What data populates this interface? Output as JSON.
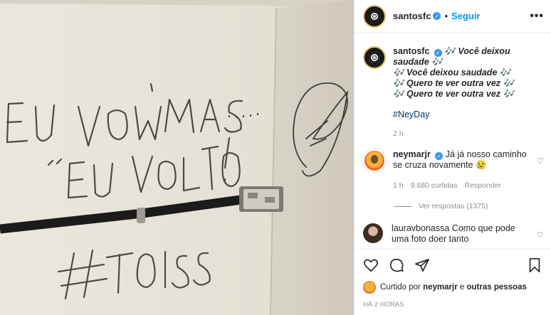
{
  "photo": {
    "alt_lines": [
      "EU VOU MAS.....",
      "\"EU VOLTO!",
      "#TOISS"
    ]
  },
  "header": {
    "username": "santosfc",
    "separator": "•",
    "follow_label": "Seguir",
    "more": "•••"
  },
  "caption": {
    "username": "santosfc",
    "lines": [
      "🎶 Você deixou saudade 🎶",
      "🎶 Você deixou saudade 🎶",
      "🎶 Quero te ver outra vez 🎶",
      "🎶 Quero te ver outra vez 🎶"
    ],
    "hashtag": "#NeyDay",
    "age": "2 h"
  },
  "comments": [
    {
      "username": "neymarjr",
      "text": "Já já nosso caminho se cruza novamente 😢",
      "age": "1 h",
      "likes": "9.680 curtidas",
      "reply": "Responder",
      "view_replies": "Ver respostas (1375)"
    },
    {
      "username": "lauravbonassa",
      "text": "Como que pode uma foto doer tanto"
    }
  ],
  "likes": {
    "prefix": "Curtido por",
    "user": "neymarjr",
    "middle": "e",
    "others": "outras pessoas"
  },
  "posted": "HÁ 2 HORAS",
  "colors": {
    "accent": "#0095f6",
    "verified": "#3897f0",
    "muted": "#8e8e8e"
  }
}
